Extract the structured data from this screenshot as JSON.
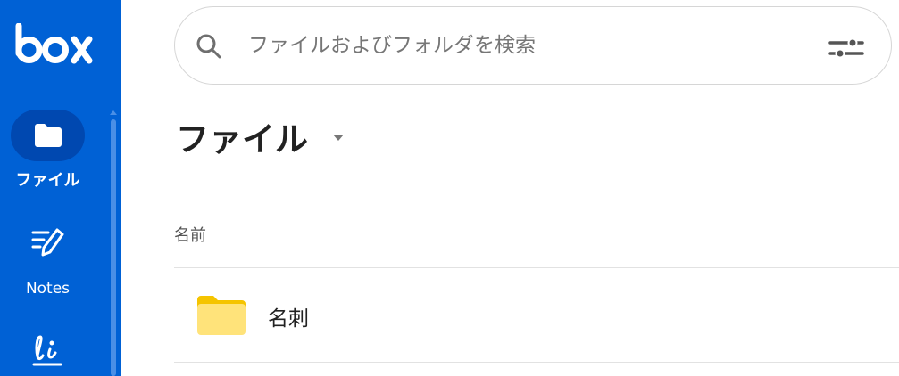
{
  "brand": {
    "logo_text": "box"
  },
  "sidebar": {
    "items": [
      {
        "label": "ファイル",
        "icon": "folder-icon",
        "active": true
      },
      {
        "label": "Notes",
        "icon": "notes-icon",
        "active": false
      },
      {
        "label": "",
        "icon": "sign-icon",
        "active": false
      }
    ]
  },
  "search": {
    "placeholder": "ファイルおよびフォルダを検索",
    "value": ""
  },
  "header": {
    "title": "ファイル"
  },
  "table": {
    "columns": [
      "名前"
    ],
    "rows": [
      {
        "name": "名刺",
        "type": "folder"
      }
    ]
  },
  "colors": {
    "sidebar": "#0061d5",
    "active_pill": "#0048b0",
    "folder": "#ffd84d"
  }
}
